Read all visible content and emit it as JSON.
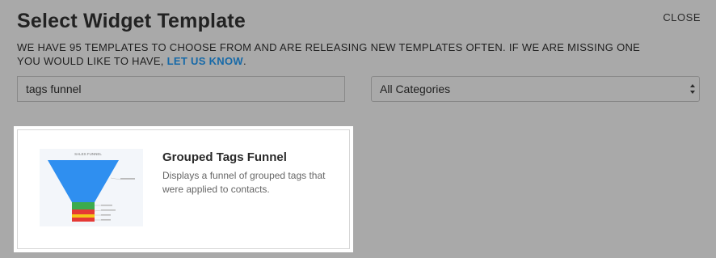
{
  "header": {
    "title": "Select Widget Template",
    "close_label": "CLOSE"
  },
  "description": {
    "text": "WE HAVE 95 TEMPLATES TO CHOOSE FROM AND ARE RELEASING NEW TEMPLATES OFTEN. IF WE ARE MISSING ONE YOU WOULD LIKE TO HAVE,",
    "link_label": "LET US KNOW",
    "end": "."
  },
  "search": {
    "value": "tags funnel"
  },
  "category_select": {
    "selected": "All Categories"
  },
  "results": [
    {
      "title": "Grouped Tags Funnel",
      "description": "Displays a funnel of grouped tags that were applied to contacts.",
      "thumbnail_title": "SALES FUNNEL"
    }
  ],
  "colors": {
    "link": "#1669a8",
    "funnel_blue": "#2f8ff0",
    "funnel_green": "#3cab4e",
    "funnel_red": "#e53935",
    "funnel_yellow": "#f5c518"
  }
}
